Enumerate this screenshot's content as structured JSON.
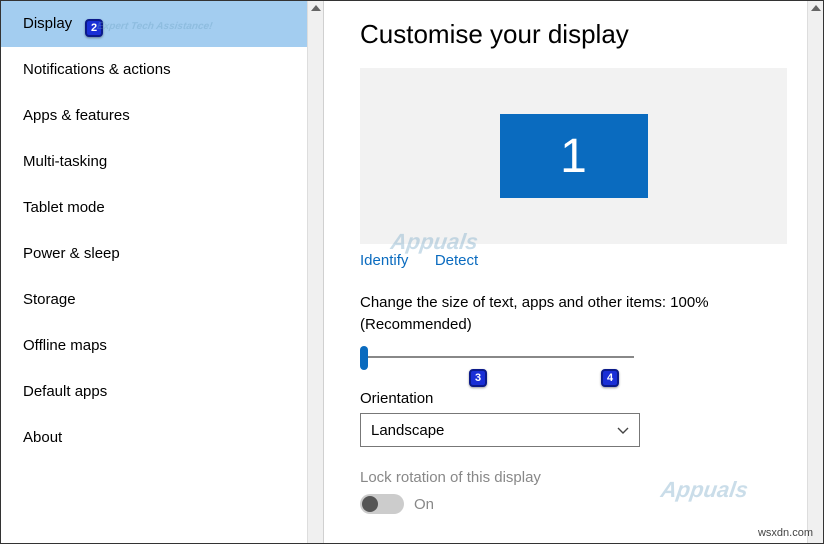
{
  "sidebar": {
    "items": [
      {
        "label": "Display",
        "selected": true
      },
      {
        "label": "Notifications & actions"
      },
      {
        "label": "Apps & features"
      },
      {
        "label": "Multi-tasking"
      },
      {
        "label": "Tablet mode"
      },
      {
        "label": "Power & sleep"
      },
      {
        "label": "Storage"
      },
      {
        "label": "Offline maps"
      },
      {
        "label": "Default apps"
      },
      {
        "label": "About"
      }
    ]
  },
  "main": {
    "title": "Customise your display",
    "monitor_number": "1",
    "identify": "Identify",
    "detect": "Detect",
    "scale_label": "Change the size of text, apps and other items: 100% (Recommended)",
    "orientation_label": "Orientation",
    "orientation_value": "Landscape",
    "lock_label": "Lock rotation of this display",
    "toggle_value": "On"
  },
  "badges": {
    "b2": "2",
    "b3": "3",
    "b4": "4"
  },
  "watermark_small": "Expert Tech Assistance!",
  "watermark_brand": "Appuals",
  "credit": "wsxdn.com"
}
